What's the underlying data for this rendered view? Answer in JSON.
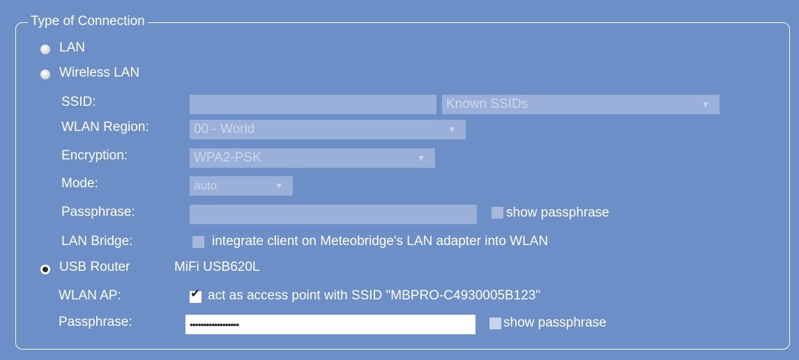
{
  "fieldset": {
    "legend": "Type of Connection"
  },
  "lan": {
    "label": "LAN",
    "checked": false
  },
  "wireless": {
    "label": "Wireless LAN",
    "checked": false,
    "ssid_label": "SSID:",
    "ssid_value": "",
    "known_ssids": "Known SSIDs",
    "region_label": "WLAN Region:",
    "region_value": "00 - World",
    "encryption_label": "Encryption:",
    "encryption_value": "WPA2-PSK",
    "mode_label": "Mode:",
    "mode_value": "auto",
    "passphrase_label": "Passphrase:",
    "passphrase_value": "",
    "show_passphrase_label": "show passphrase",
    "bridge_label": "LAN Bridge:",
    "bridge_text": "integrate client on Meteobridge's LAN adapter into WLAN"
  },
  "usb": {
    "label": "USB Router",
    "checked": true,
    "device": "MiFi USB620L",
    "ap_label": "WLAN AP:",
    "ap_text": "act as access point with SSID \"MBPRO-C4930005B123\"",
    "ap_checked": true,
    "passphrase_label": "Passphrase:",
    "passphrase_value": "••••••••••••••••••",
    "show_passphrase_label": "show passphrase"
  },
  "icons": {
    "dropdown": "▼"
  }
}
